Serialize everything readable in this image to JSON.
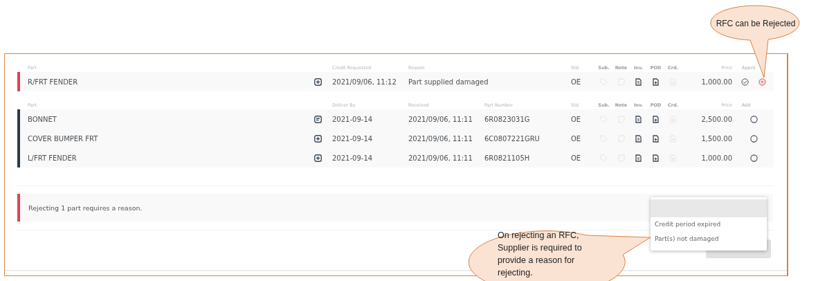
{
  "rfc_section": {
    "headers": {
      "part": "Part",
      "col_1": "Credit Requested",
      "col_2": "Reason",
      "std": "Std.",
      "sub": "Sub.",
      "note": "Note",
      "inv": "Inv.",
      "pod": "POD",
      "crd": "Crd.",
      "price": "Price",
      "action": "Appro"
    },
    "rows": [
      {
        "part": "R/FRT FENDER",
        "kind": "add",
        "col_1": "2021/09/06, 11:12",
        "col_2": "Part supplied damaged",
        "std": "OE",
        "docs": {
          "sub": false,
          "note": false,
          "inv": true,
          "pod": true,
          "crd": false
        },
        "price": "1,000.00",
        "approved": false,
        "rejected": true
      }
    ]
  },
  "parts_section": {
    "headers": {
      "part": "Part",
      "col_1": "Deliver By",
      "col_2": "Received",
      "col_3": "Part Number",
      "std": "Std.",
      "sub": "Sub.",
      "note": "Note",
      "inv": "Inv.",
      "pod": "POD",
      "crd": "Crd.",
      "price": "Price",
      "action": "Add"
    },
    "rows": [
      {
        "part": "BONNET",
        "kind": "note",
        "col_1": "2021-09-14",
        "col_2": "2021/09/06, 11:11",
        "col_3": "6R0823031G",
        "std": "OE",
        "docs": {
          "sub": false,
          "note": false,
          "inv": true,
          "pod": true,
          "crd": false
        },
        "price": "2,500.00",
        "checked": false
      },
      {
        "part": "COVER BUMPER FRT",
        "kind": "add",
        "col_1": "2021-09-14",
        "col_2": "2021/09/06, 11:11",
        "col_3": "6C0807221GRU",
        "std": "OE",
        "docs": {
          "sub": false,
          "note": false,
          "inv": true,
          "pod": true,
          "crd": false
        },
        "price": "1,500.00",
        "checked": false
      },
      {
        "part": "L/FRT FENDER",
        "kind": "add",
        "col_1": "2021-09-14",
        "col_2": "2021/09/06, 11:11",
        "col_3": "6R0821105H",
        "std": "OE",
        "docs": {
          "sub": false,
          "note": false,
          "inv": true,
          "pod": true,
          "crd": false
        },
        "price": "1,000.00",
        "checked": false
      }
    ]
  },
  "alert": {
    "text": "Rejecting 1 part requires a reason."
  },
  "reason_dropdown": {
    "options": [
      {
        "label": "Credit period expired",
        "selected": false
      },
      {
        "label": "Part(s) not damaged",
        "selected": false
      }
    ]
  },
  "callouts": [
    {
      "text": "RFC can be Rejected"
    },
    {
      "lines": [
        "On rejecting an RFC,",
        "Supplier is required to",
        "provide a reason for",
        "rejecting."
      ]
    }
  ]
}
